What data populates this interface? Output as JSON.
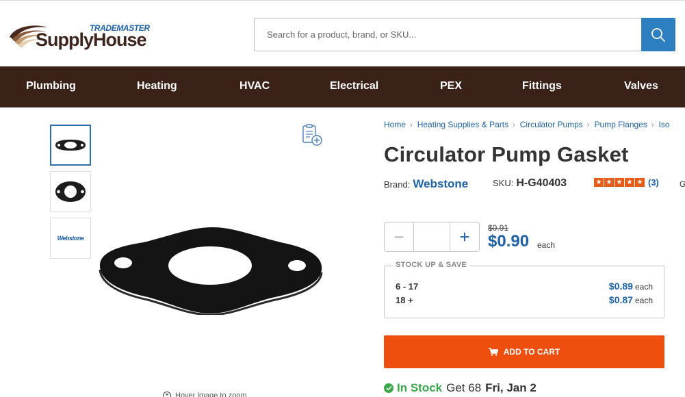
{
  "header": {
    "logo_top": "TRADEMASTER",
    "logo_main": "SupplyHouse",
    "search_placeholder": "Search for a product, brand, or SKU..."
  },
  "nav": [
    {
      "label": "Plumbing"
    },
    {
      "label": "Heating"
    },
    {
      "label": "HVAC"
    },
    {
      "label": "Electrical"
    },
    {
      "label": "PEX"
    },
    {
      "label": "Fittings"
    },
    {
      "label": "Valves"
    }
  ],
  "gallery": {
    "thumb_brand_text": "Webstone",
    "zoom_hint": "Hover image to zoom"
  },
  "breadcrumb": [
    {
      "label": "Home"
    },
    {
      "label": "Heating Supplies & Parts"
    },
    {
      "label": "Circulator Pumps"
    },
    {
      "label": "Pump Flanges"
    },
    {
      "label": "Iso"
    }
  ],
  "product": {
    "title": "Circulator Pump Gasket",
    "brand_label": "Brand:",
    "brand": "Webstone",
    "sku_label": "SKU:",
    "sku": "H-G40403",
    "rating_stars": 5,
    "review_count": "(3)",
    "edge_text": "G"
  },
  "pricing": {
    "quantity": "",
    "old_price": "$0.91",
    "price": "$0.90",
    "each": "each"
  },
  "stockup": {
    "title": "STOCK UP & SAVE",
    "tiers": [
      {
        "range": "6 - 17",
        "price": "$0.89",
        "each": "each"
      },
      {
        "range": "18 +",
        "price": "$0.87",
        "each": "each"
      }
    ]
  },
  "cart": {
    "label": "ADD TO CART"
  },
  "availability": {
    "status": "In Stock",
    "get_text": "Get 68",
    "date": "Fri, Jan 2"
  },
  "colors": {
    "nav_bg": "#3b2219",
    "link_blue": "#1e62a8",
    "cart_orange": "#ee4e0e",
    "stock_green": "#3aa84a"
  }
}
